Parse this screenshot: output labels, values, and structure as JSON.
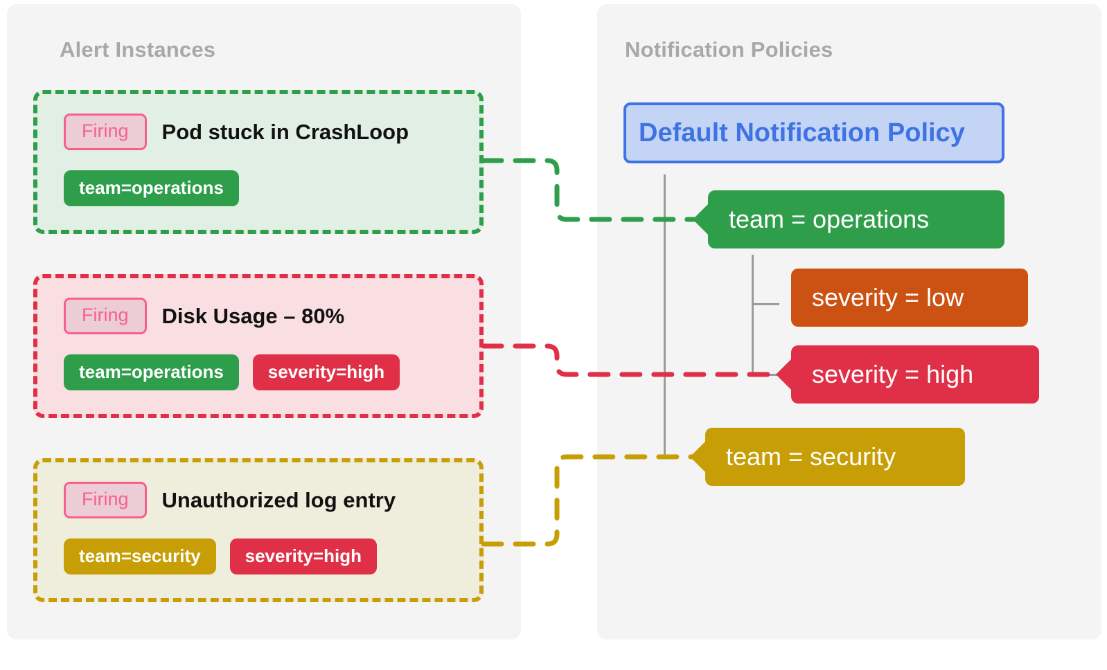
{
  "panels": {
    "alerts": {
      "title": "Alert Instances"
    },
    "policies": {
      "title": "Notification Policies"
    }
  },
  "alert_instances": [
    {
      "state": "Firing",
      "title": "Pod stuck in CrashLoop",
      "labels": [
        {
          "text": "team=operations",
          "color": "#2E9E4B"
        }
      ],
      "border_color": "#2E9E4B",
      "background_color": "#e2efe4",
      "routes_to": "team = operations"
    },
    {
      "state": "Firing",
      "title": "Disk Usage – 80%",
      "labels": [
        {
          "text": "team=operations",
          "color": "#2E9E4B"
        },
        {
          "text": "severity=high",
          "color": "#DF3048"
        }
      ],
      "border_color": "#DF3048",
      "background_color": "#f9dfe2",
      "routes_to": "severity = high"
    },
    {
      "state": "Firing",
      "title": "Unauthorized log entry",
      "labels": [
        {
          "text": "team=security",
          "color": "#C79E06"
        },
        {
          "text": "severity=high",
          "color": "#DF3048"
        }
      ],
      "border_color": "#C79E06",
      "background_color": "#efeddc",
      "routes_to": "team = security"
    }
  ],
  "notification_policy_tree": {
    "root": {
      "label": "Default Notification Policy",
      "text_color": "#3F73E3",
      "fill_color": "#C3D4F5"
    },
    "children": [
      {
        "label": "team = operations",
        "color": "#2E9E4B",
        "children": [
          {
            "label": "severity = low",
            "color": "#CC5214"
          },
          {
            "label": "severity = high",
            "color": "#DF3048"
          }
        ]
      },
      {
        "label": "team = security",
        "color": "#C79E06"
      }
    ]
  },
  "connector_colors": {
    "alert_0": "#2E9E4B",
    "alert_1": "#DF3048",
    "alert_2": "#C79E06"
  }
}
